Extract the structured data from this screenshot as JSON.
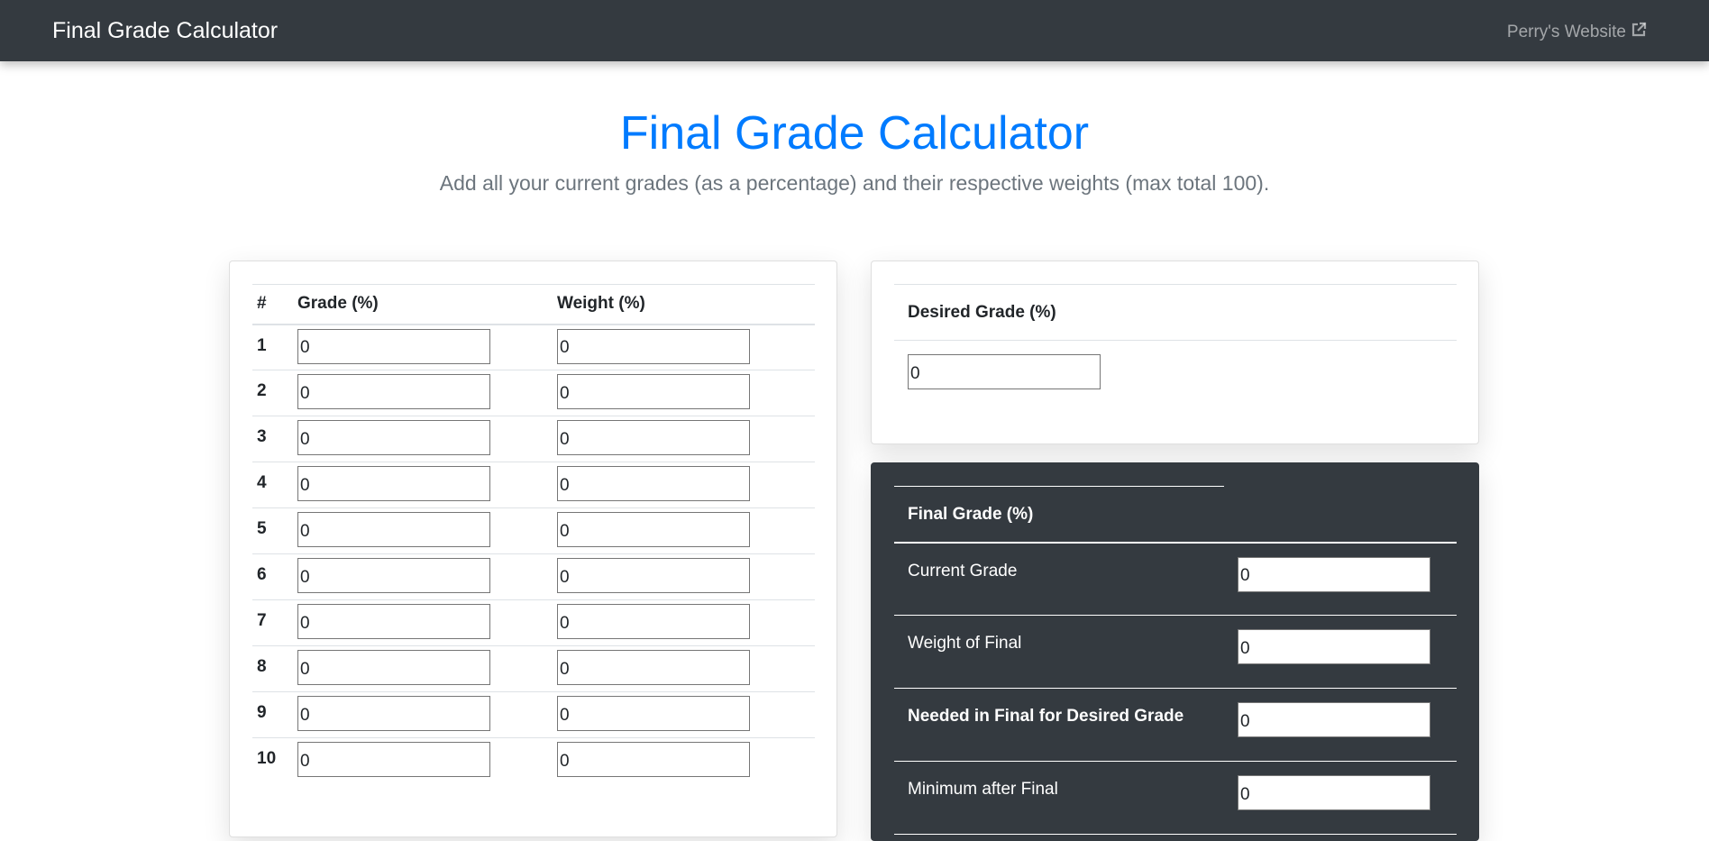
{
  "navbar": {
    "brand": "Final Grade Calculator",
    "external_link": "Perry's Website"
  },
  "header": {
    "title": "Final Grade Calculator",
    "subtitle": "Add all your current grades (as a percentage) and their respective weights (max total 100)."
  },
  "grades_table": {
    "col_num": "#",
    "col_grade": "Grade (%)",
    "col_weight": "Weight (%)",
    "rows": [
      {
        "num": "1",
        "grade": "0",
        "weight": "0"
      },
      {
        "num": "2",
        "grade": "0",
        "weight": "0"
      },
      {
        "num": "3",
        "grade": "0",
        "weight": "0"
      },
      {
        "num": "4",
        "grade": "0",
        "weight": "0"
      },
      {
        "num": "5",
        "grade": "0",
        "weight": "0"
      },
      {
        "num": "6",
        "grade": "0",
        "weight": "0"
      },
      {
        "num": "7",
        "grade": "0",
        "weight": "0"
      },
      {
        "num": "8",
        "grade": "0",
        "weight": "0"
      },
      {
        "num": "9",
        "grade": "0",
        "weight": "0"
      },
      {
        "num": "10",
        "grade": "0",
        "weight": "0"
      }
    ]
  },
  "desired": {
    "label": "Desired Grade (%)",
    "value": "0"
  },
  "final": {
    "header": "Final Grade (%)",
    "current_grade_label": "Current Grade",
    "current_grade_value": "0",
    "weight_of_final_label": "Weight of Final",
    "weight_of_final_value": "0",
    "needed_label": "Needed in Final for Desired Grade",
    "needed_value": "0",
    "minimum_label": "Minimum after Final",
    "minimum_value": "0"
  },
  "colors": {
    "navbar_bg": "#343a40",
    "title_blue": "#007bff",
    "subtitle_gray": "#6c757d",
    "dark_card": "#343a40"
  },
  "icons": {
    "external_link": "external-link-icon"
  }
}
